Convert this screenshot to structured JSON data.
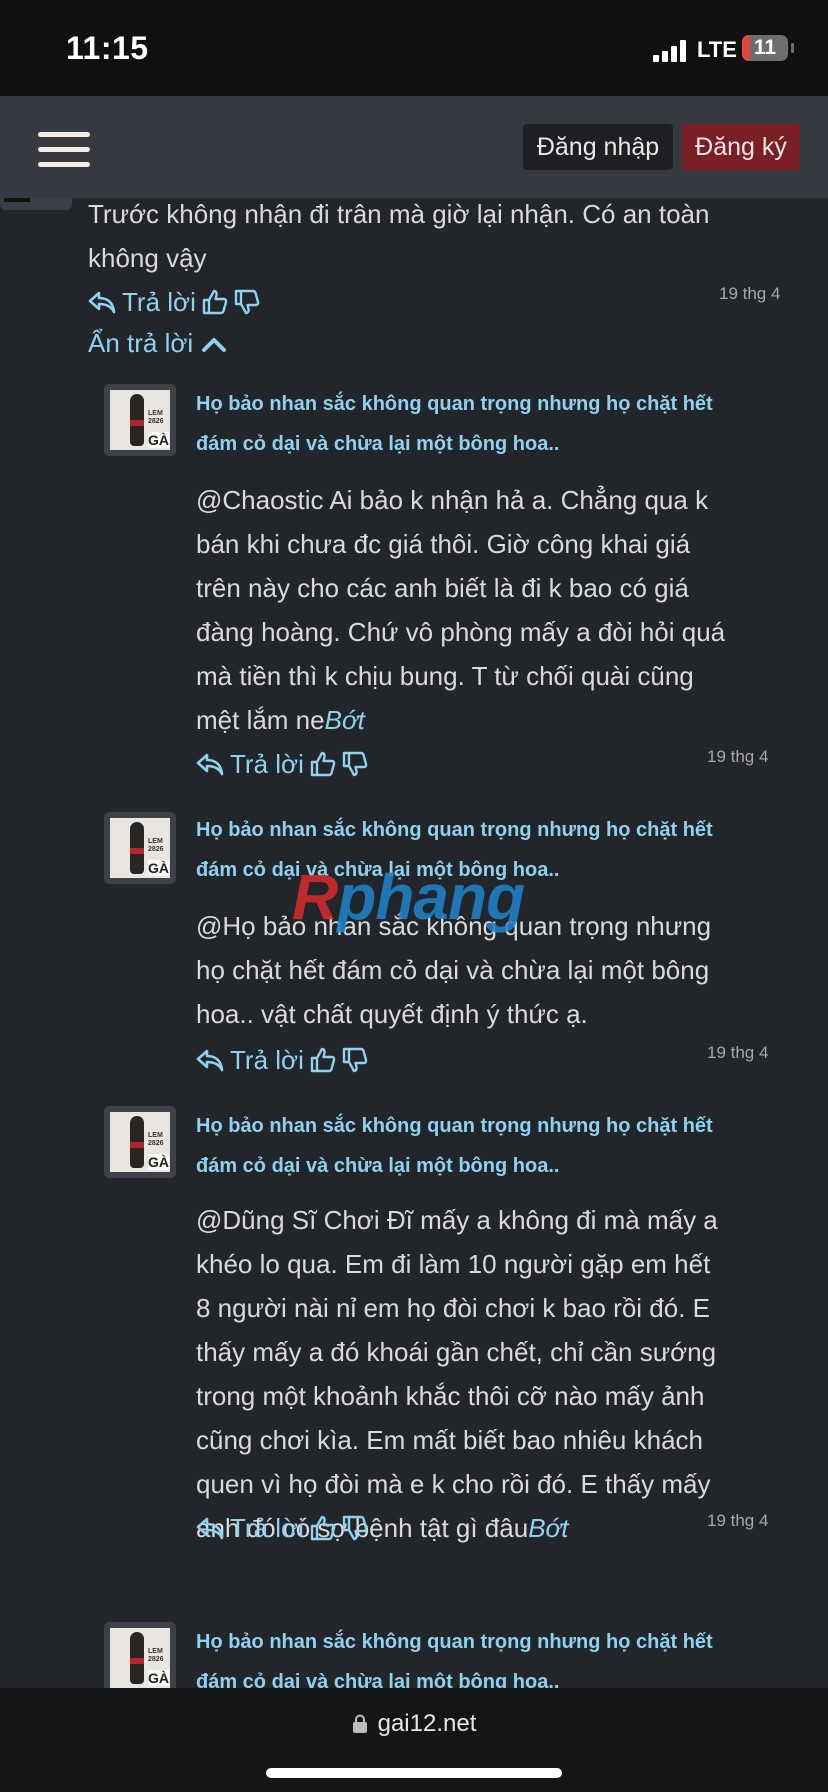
{
  "status": {
    "time": "11:15",
    "network": "LTE",
    "battery": "11",
    "battery_level": 0.11
  },
  "nav": {
    "login": "Đăng nhập",
    "register": "Đăng ký"
  },
  "top_comment": {
    "line1": "Trước không nhận đi trân mà giờ lại nhận. Có an toàn",
    "line2": "không vậy",
    "reply_label": "Trả lời",
    "date": "19 thg 4",
    "hide_replies": "Ẩn trả lời"
  },
  "replies": [
    {
      "author_line1": "Họ bảo nhan sắc không quan trọng nhưng họ chặt hết",
      "author_line2": "đám cỏ dại và chừa lại một bông hoa..",
      "avatar_badge": "GÀ",
      "lines": [
        "@Chaostic Ai bảo k nhận hả a. Chẳng qua k",
        "bán khi chưa đc giá thôi. Giờ công khai giá",
        "trên này cho các anh biết là đi k bao có giá",
        "đàng hoàng. Chứ vô phòng mấy a đòi hỏi quá",
        "mà tiền thì k chịu bung. T từ chối quài cũng",
        "mệt lắm ne"
      ],
      "suffix": "Bớt",
      "reply_label": "Trả lời",
      "date": "19 thg 4"
    },
    {
      "author_line1": "Họ bảo nhan sắc không quan trọng nhưng họ chặt hết",
      "author_line2": "đám cỏ dại và chừa lại một bông hoa..",
      "avatar_badge": "GÀ",
      "lines": [
        "@Họ bảo nhan sắc không quan trọng nhưng",
        "họ chặt hết đám cỏ dại và chừa lại một bông",
        "hoa.. vật chất quyết định ý thức ạ."
      ],
      "reply_label": "Trả lời",
      "date": "19 thg 4"
    },
    {
      "author_line1": "Họ bảo nhan sắc không quan trọng nhưng họ chặt hết",
      "author_line2": "đám cỏ dại và chừa lại một bông hoa..",
      "avatar_badge": "GÀ",
      "lines": [
        "@Dũng Sĩ Chơi Đĩ mấy a không đi mà mấy a",
        "khéo lo qua. Em đi làm 10 người gặp em hết",
        "8 người nài nỉ em họ đòi chơi k bao rồi đó. E",
        "thấy mấy a đó khoái gần chết, chỉ cần sướng",
        "trong một khoảnh khắc thôi cỡ nào mấy ảnh",
        "cũng chơi kìa. Em mất biết bao nhiêu khách",
        "quen vì họ đòi mà e k cho rồi đó. E thấy mấy",
        "anh đó có sợ bệnh tật gì đâu"
      ],
      "suffix": "Bớt",
      "reply_label": "Trả lời",
      "date": "19 thg 4"
    },
    {
      "author_line1": "Họ bảo nhan sắc không quan trọng nhưng họ chặt hết",
      "author_line2": "đám cỏ dại và chừa lại một bông hoa..",
      "avatar_badge": "GÀ"
    }
  ],
  "watermark": {
    "first": "R",
    "rest": "phang"
  },
  "browser": {
    "url": "gai12.net"
  },
  "icons": [
    "reply-arrow-icon",
    "thumbs-up-icon",
    "thumbs-down-icon",
    "chevron-up-icon",
    "lock-icon",
    "hamburger-menu-icon"
  ],
  "colors": {
    "background": "#22252a",
    "link": "#8fd1ef",
    "register_button": "#7a1f26",
    "nav": "#363a40"
  }
}
